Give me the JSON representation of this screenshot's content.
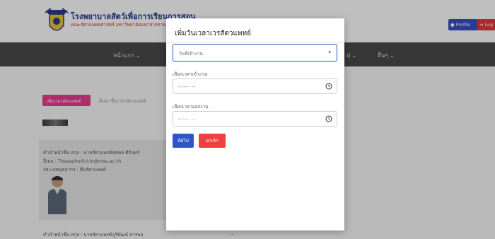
{
  "header": {
    "title": "โรงพยาบาลสัตว์เพื่อการเรียนการสอน",
    "subtitle": "คณะสัตวแพทยศาสตร์ มหาวิทยาลัยมหาสารคาม",
    "profile_label": "Profile",
    "logout_label": "Log"
  },
  "nav": {
    "items": [
      {
        "label": "หน้าแรก ⌄"
      },
      {
        "label": "ป ⌄"
      },
      {
        "label": "อื่นๆ ⌄"
      }
    ]
  },
  "background": {
    "vet_pill": "เพิ่มเวลาสัตวแพทย์",
    "search_text": "ค้นหาชื่อเวลาสัตวแพทย์",
    "card": {
      "line1": "คำนำหน้าชื่อ-สกุล : นายสัตวแพทย์ทศพล ศิรินทร์",
      "line2": "อีเมล : ThosaphoISririn@msu.ac.th",
      "line3": "ประเภทบุคลากร : ทีมสัตวแพทย์"
    },
    "bottom_line": "คำนำหน้าชื่อ-สกุล : นายสัตวแพทย์ภูริพัฒน์ สารพล",
    "chev": "⌄"
  },
  "modal": {
    "title": "เพิ่มวันเวลาเวรสัตวแพทย์",
    "select_placeholder": "วันที่เข้างาน",
    "start_label": "เลือกเวลาเข้างาน",
    "start_value": "--:-- --",
    "end_label": "เลือกเวลาออกงาน",
    "end_value": "--:-- --",
    "next_label": "ถัดไป",
    "cancel_label": "ยกเลิก"
  },
  "colors": {
    "primary": "#2f56c9",
    "danger": "#ef4040",
    "pink": "#e83e8c",
    "navbar": "#4a4a4a"
  }
}
